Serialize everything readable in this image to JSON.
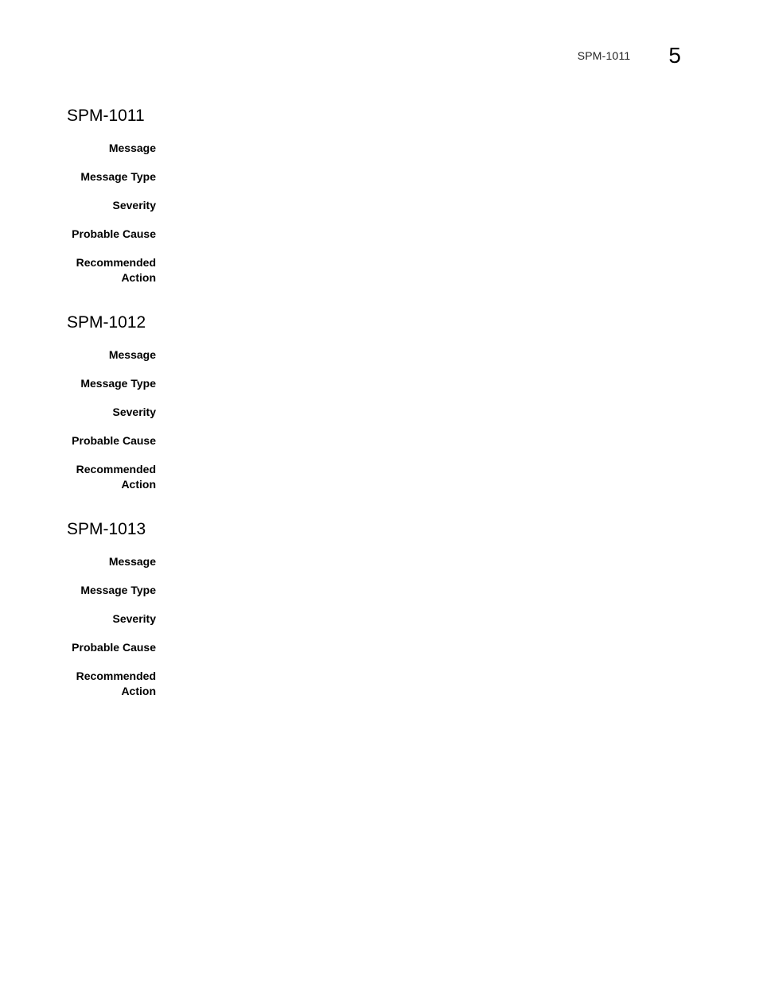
{
  "header": {
    "running_title": "SPM-1011",
    "chapter_number": "5"
  },
  "sections": [
    {
      "title": "SPM-1011",
      "fields": [
        {
          "label": "Message",
          "value": ""
        },
        {
          "label": "Message Type",
          "value": ""
        },
        {
          "label": "Severity",
          "value": ""
        },
        {
          "label": "Probable Cause",
          "value": ""
        },
        {
          "label": "Recommended Action",
          "value": ""
        }
      ]
    },
    {
      "title": "SPM-1012",
      "fields": [
        {
          "label": "Message",
          "value": ""
        },
        {
          "label": "Message Type",
          "value": ""
        },
        {
          "label": "Severity",
          "value": ""
        },
        {
          "label": "Probable Cause",
          "value": ""
        },
        {
          "label": "Recommended Action",
          "value": ""
        }
      ]
    },
    {
      "title": "SPM-1013",
      "fields": [
        {
          "label": "Message",
          "value": ""
        },
        {
          "label": "Message Type",
          "value": ""
        },
        {
          "label": "Severity",
          "value": ""
        },
        {
          "label": "Probable Cause",
          "value": ""
        },
        {
          "label": "Recommended Action",
          "value": ""
        }
      ]
    }
  ]
}
